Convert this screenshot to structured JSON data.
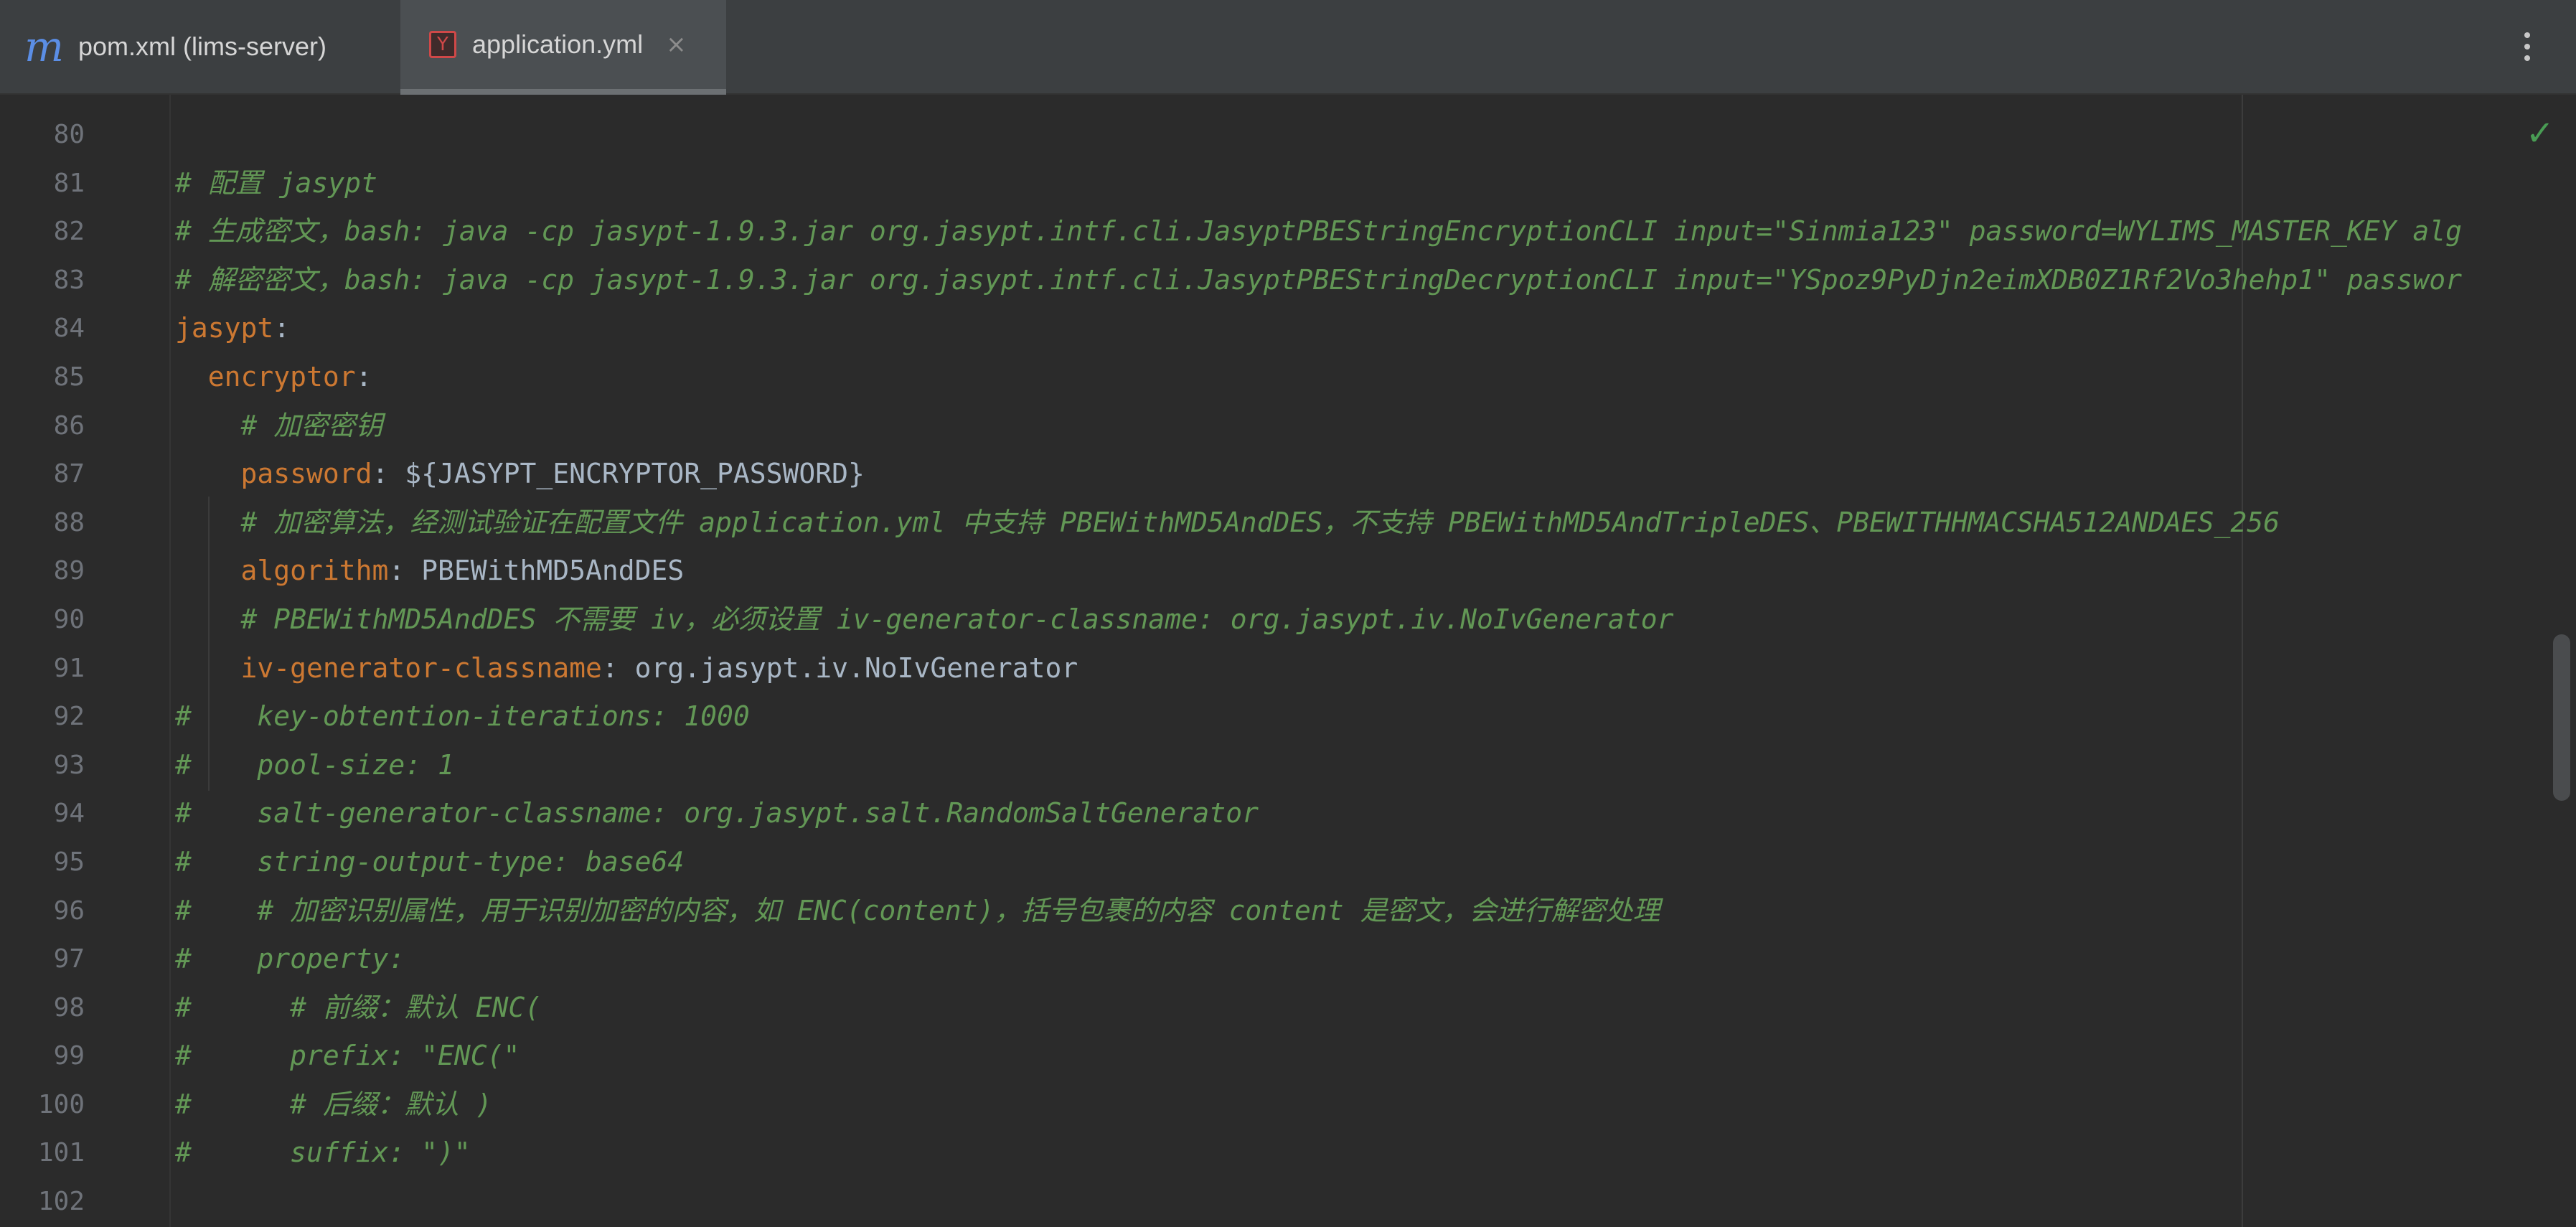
{
  "tabs": [
    {
      "icon": "maven-icon",
      "label": "pom.xml (lims-server)",
      "active": false
    },
    {
      "icon": "yaml-icon",
      "label": "application.yml",
      "active": true,
      "close": "×"
    }
  ],
  "tab_icons": {
    "pom": "m",
    "yml": "Y"
  },
  "status": {
    "check": "✓"
  },
  "lines": [
    {
      "n": "80",
      "segments": []
    },
    {
      "n": "81",
      "segments": [
        {
          "t": "# 配置 jasypt",
          "c": "comment"
        }
      ]
    },
    {
      "n": "82",
      "segments": [
        {
          "t": "# 生成密文，bash: java -cp jasypt-1.9.3.jar org.jasypt.intf.cli.JasyptPBEStringEncryptionCLI input=\"Sinmia123\" password=WYLIMS_MASTER_KEY alg",
          "c": "comment"
        }
      ]
    },
    {
      "n": "83",
      "segments": [
        {
          "t": "# 解密密文，bash: java -cp jasypt-1.9.3.jar org.jasypt.intf.cli.JasyptPBEStringDecryptionCLI input=\"YSpoz9PyDjn2eimXDB0Z1Rf2Vo3hehp1\" passwor",
          "c": "comment"
        }
      ]
    },
    {
      "n": "84",
      "segments": [
        {
          "t": "jasypt",
          "c": "key"
        },
        {
          "t": ":",
          "c": "val"
        }
      ]
    },
    {
      "n": "85",
      "segments": [
        {
          "t": "  ",
          "c": "val"
        },
        {
          "t": "encryptor",
          "c": "key"
        },
        {
          "t": ":",
          "c": "val"
        }
      ]
    },
    {
      "n": "86",
      "segments": [
        {
          "t": "    ",
          "c": "val"
        },
        {
          "t": "# 加密密钥",
          "c": "comment"
        }
      ]
    },
    {
      "n": "87",
      "segments": [
        {
          "t": "    ",
          "c": "val"
        },
        {
          "t": "password",
          "c": "key"
        },
        {
          "t": ": ${JASYPT_ENCRYPTOR_PASSWORD}",
          "c": "val"
        }
      ]
    },
    {
      "n": "88",
      "segments": [
        {
          "t": "    ",
          "c": "val"
        },
        {
          "t": "# 加密算法，经测试验证在配置文件 application.yml 中支持 PBEWithMD5AndDES，不支持 PBEWithMD5AndTripleDES、PBEWITHHMACSHA512ANDAES_256",
          "c": "comment"
        }
      ]
    },
    {
      "n": "89",
      "segments": [
        {
          "t": "    ",
          "c": "val"
        },
        {
          "t": "algorithm",
          "c": "key"
        },
        {
          "t": ": PBEWithMD5AndDES",
          "c": "val"
        }
      ]
    },
    {
      "n": "90",
      "segments": [
        {
          "t": "    ",
          "c": "val"
        },
        {
          "t": "# PBEWithMD5AndDES 不需要 iv，必须设置 iv-generator-classname: org.jasypt.iv.NoIvGenerator",
          "c": "comment"
        }
      ]
    },
    {
      "n": "91",
      "segments": [
        {
          "t": "    ",
          "c": "val"
        },
        {
          "t": "iv-generator-classname",
          "c": "key"
        },
        {
          "t": ": org.jasypt.iv.NoIvGenerator",
          "c": "val"
        }
      ]
    },
    {
      "n": "92",
      "segments": [
        {
          "t": "#    key-obtention-iterations: 1000",
          "c": "comment"
        }
      ]
    },
    {
      "n": "93",
      "segments": [
        {
          "t": "#    pool-size: 1",
          "c": "comment"
        }
      ]
    },
    {
      "n": "94",
      "segments": [
        {
          "t": "#    salt-generator-classname: org.jasypt.salt.RandomSaltGenerator",
          "c": "comment"
        }
      ]
    },
    {
      "n": "95",
      "segments": [
        {
          "t": "#    string-output-type: base64",
          "c": "comment"
        }
      ]
    },
    {
      "n": "96",
      "segments": [
        {
          "t": "#    # 加密识别属性，用于识别加密的内容，如 ENC(content)，括号包裹的内容 content 是密文，会进行解密处理",
          "c": "comment"
        }
      ]
    },
    {
      "n": "97",
      "segments": [
        {
          "t": "#    property:",
          "c": "comment"
        }
      ]
    },
    {
      "n": "98",
      "segments": [
        {
          "t": "#      # 前缀：默认 ENC(",
          "c": "comment"
        }
      ]
    },
    {
      "n": "99",
      "segments": [
        {
          "t": "#      prefix: \"ENC(\"",
          "c": "comment"
        }
      ]
    },
    {
      "n": "100",
      "segments": [
        {
          "t": "#      # 后缀：默认 )",
          "c": "comment"
        }
      ]
    },
    {
      "n": "101",
      "segments": [
        {
          "t": "#      suffix: \")\"",
          "c": "comment"
        }
      ]
    },
    {
      "n": "102",
      "segments": []
    }
  ]
}
